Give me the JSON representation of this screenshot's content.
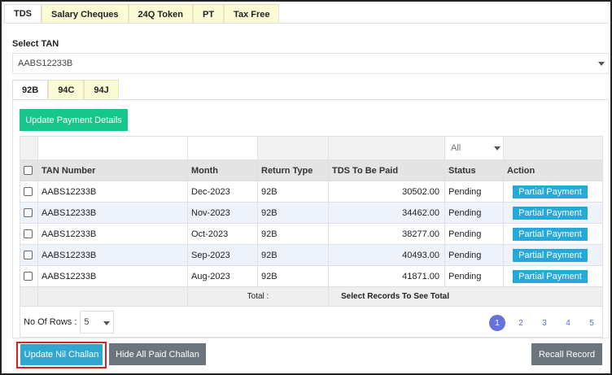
{
  "top_tabs": [
    "TDS",
    "Salary Cheques",
    "24Q Token",
    "PT",
    "Tax Free"
  ],
  "select_tan": {
    "label": "Select TAN",
    "value": "AABS12233B"
  },
  "sub_tabs": [
    "92B",
    "94C",
    "94J"
  ],
  "update_payment_label": "Update Payment Details",
  "table": {
    "status_filter": "All",
    "headers": [
      "TAN Number",
      "Month",
      "Return Type",
      "TDS To Be Paid",
      "Status",
      "Action"
    ],
    "rows": [
      {
        "tan": "AABS12233B",
        "month": "Dec-2023",
        "type": "92B",
        "amount": "30502.00",
        "status": "Pending",
        "action": "Partial Payment"
      },
      {
        "tan": "AABS12233B",
        "month": "Nov-2023",
        "type": "92B",
        "amount": "34462.00",
        "status": "Pending",
        "action": "Partial Payment"
      },
      {
        "tan": "AABS12233B",
        "month": "Oct-2023",
        "type": "92B",
        "amount": "38277.00",
        "status": "Pending",
        "action": "Partial Payment"
      },
      {
        "tan": "AABS12233B",
        "month": "Sep-2023",
        "type": "92B",
        "amount": "40493.00",
        "status": "Pending",
        "action": "Partial Payment"
      },
      {
        "tan": "AABS12233B",
        "month": "Aug-2023",
        "type": "92B",
        "amount": "41871.00",
        "status": "Pending",
        "action": "Partial Payment"
      }
    ],
    "total_label": "Total :",
    "total_hint": "Select Records To See Total"
  },
  "pager": {
    "rows_label": "No Of Rows :",
    "rows_value": "5",
    "pages": [
      "1",
      "2",
      "3",
      "4",
      "5"
    ],
    "active_page": "1"
  },
  "footer": {
    "nil_challan": "Update Nil Challan",
    "hide_paid": "Hide All Paid Challan",
    "recall": "Recall Record"
  },
  "colors": {
    "green": "#17c68b",
    "blue": "#31a6cf",
    "gray": "#6c757d",
    "highlight": "#d32424",
    "page_active": "#6673dc"
  }
}
